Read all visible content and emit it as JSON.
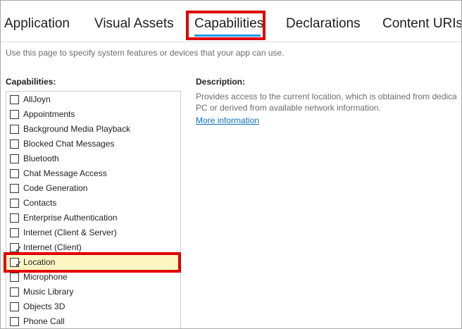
{
  "tabs": [
    {
      "label": "Application"
    },
    {
      "label": "Visual Assets"
    },
    {
      "label": "Capabilities"
    },
    {
      "label": "Declarations"
    },
    {
      "label": "Content URIs"
    }
  ],
  "active_tab": "Capabilities",
  "intro": "Use this page to specify system features or devices that your app can use.",
  "capabilities_heading": "Capabilities:",
  "description": {
    "heading": "Description:",
    "text": "Provides access to the current location, which is obtained from dedicate\nPC or derived from available network information.",
    "link": "More information"
  },
  "capabilities": [
    {
      "label": "AllJoyn",
      "checked": false
    },
    {
      "label": "Appointments",
      "checked": false
    },
    {
      "label": "Background Media Playback",
      "checked": false
    },
    {
      "label": "Blocked Chat Messages",
      "checked": false
    },
    {
      "label": "Bluetooth",
      "checked": false
    },
    {
      "label": "Chat Message Access",
      "checked": false
    },
    {
      "label": "Code Generation",
      "checked": false
    },
    {
      "label": "Contacts",
      "checked": false
    },
    {
      "label": "Enterprise Authentication",
      "checked": false
    },
    {
      "label": "Internet (Client & Server)",
      "checked": false
    },
    {
      "label": "Internet (Client)",
      "checked": true
    },
    {
      "label": "Location",
      "checked": true,
      "selected": true
    },
    {
      "label": "Microphone",
      "checked": false
    },
    {
      "label": "Music Library",
      "checked": false
    },
    {
      "label": "Objects 3D",
      "checked": false
    },
    {
      "label": "Phone Call",
      "checked": false
    }
  ],
  "check_glyph": "✓",
  "colors": {
    "accent": "#1c97ea",
    "highlight_box": "#e00000",
    "selected_row": "#fef7c4",
    "link": "#0e70c0"
  }
}
